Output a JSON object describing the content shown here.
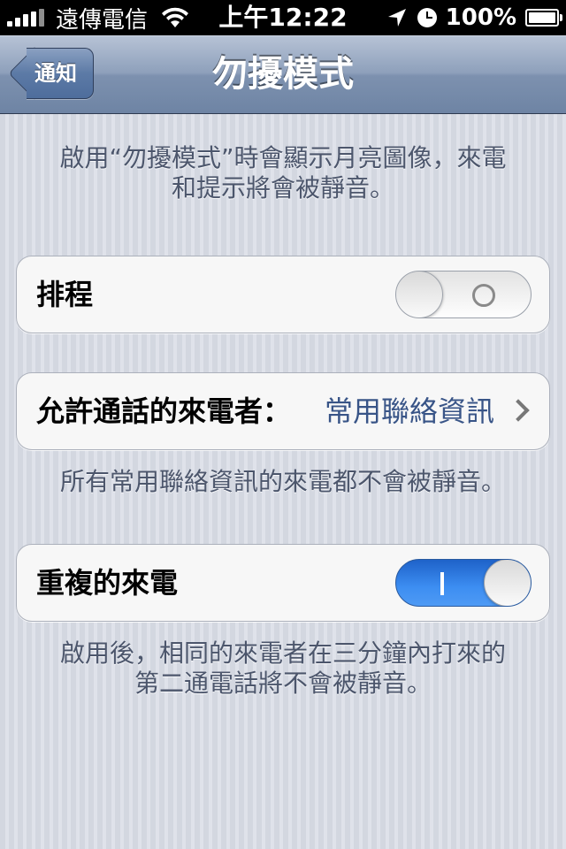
{
  "status_bar": {
    "carrier": "遠傳電信",
    "time": "上午12:22",
    "battery": "100%",
    "icons": [
      "signal-icon",
      "wifi-icon",
      "location-icon",
      "alarm-clock-icon",
      "battery-icon"
    ]
  },
  "nav": {
    "back_label": "通知",
    "title": "勿擾模式"
  },
  "intro": {
    "line1": "啟用“勿擾模式”時會顯示月亮圖像，來電",
    "line2": "和提示將會被靜音。"
  },
  "schedule": {
    "label": "排程",
    "switch_state": "off"
  },
  "allow_calls": {
    "label": "允許通話的來電者：",
    "value": "常用聯絡資訊",
    "footer": "所有常用聯絡資訊的來電都不會被靜音。"
  },
  "repeated_calls": {
    "label": "重複的來電",
    "switch_state": "on",
    "footer_line1": "啟用後，相同的來電者在三分鐘內打來的",
    "footer_line2": "第二通電話將不會被靜音。"
  },
  "colors": {
    "nav_bar": "#7d91af",
    "switch_on": "#3d8ef2",
    "value_text": "#385487",
    "description_text": "#4c566c"
  }
}
